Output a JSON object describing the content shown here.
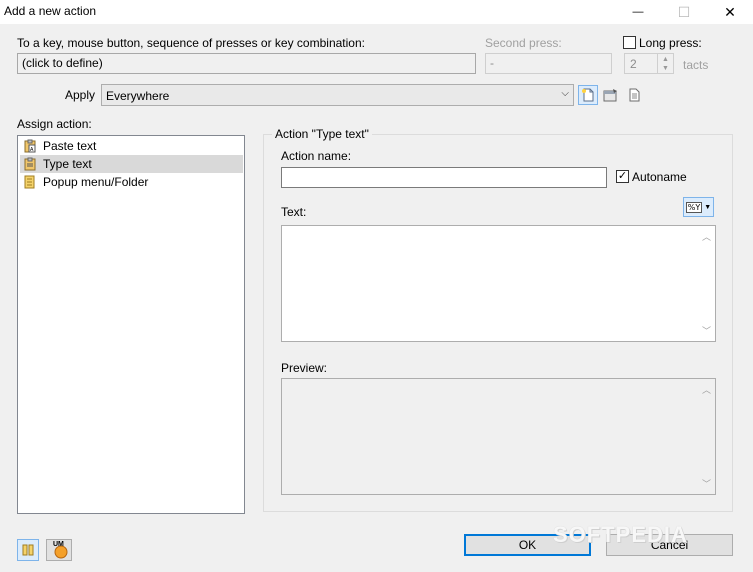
{
  "window": {
    "title": "Add a new action",
    "minimize_glyph": "—",
    "maximize_glyph": "☐",
    "close_glyph": "✕"
  },
  "trigger": {
    "label": "To a key, mouse button, sequence of presses or key combination:",
    "value": "(click to define)"
  },
  "second_press": {
    "label": "Second press:",
    "value": "-"
  },
  "long_press": {
    "label": "Long press:",
    "checked": false,
    "value": "2",
    "unit": "tacts"
  },
  "apply": {
    "label": "Apply",
    "value": "Everywhere"
  },
  "assign": {
    "label": "Assign action:",
    "items": [
      {
        "label": "Paste text",
        "selected": false
      },
      {
        "label": "Type text",
        "selected": true
      },
      {
        "label": "Popup menu/Folder",
        "selected": false
      }
    ]
  },
  "action_group": {
    "title": "Action \"Type text\"",
    "name_label": "Action name:",
    "name_value": "",
    "autoname_label": "Autoname",
    "autoname_checked": true,
    "text_label": "Text:",
    "text_value": "",
    "macro_button_label": "%Y",
    "preview_label": "Preview:",
    "preview_value": ""
  },
  "footer": {
    "ok_label": "OK",
    "cancel_label": "Cancel",
    "um_label": "UM"
  },
  "watermark": "SOFTPEDIA",
  "colors": {
    "focus_blue": "#0078d7",
    "selection_gray": "#d9d9d9",
    "window_bg": "#f0f0f0"
  }
}
